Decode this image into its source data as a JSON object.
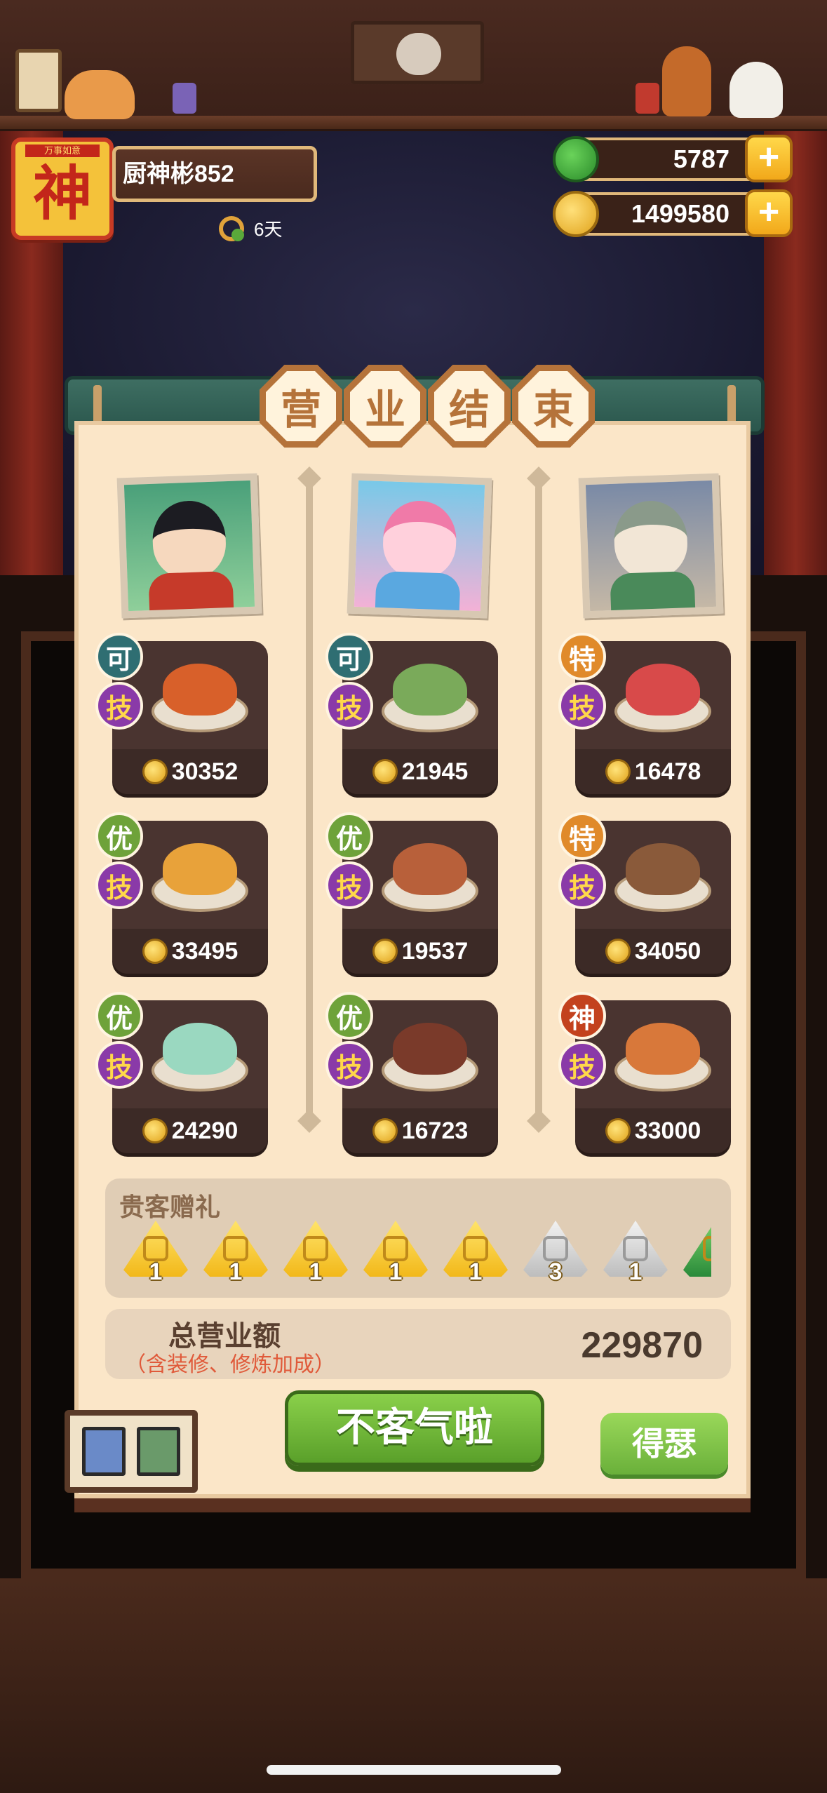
{
  "player": {
    "avatar_glyph": "神",
    "avatar_ribbon": "万事如意",
    "name": "厨神彬852",
    "days": "6天"
  },
  "currencies": {
    "jade": "5787",
    "coins": "1499580",
    "add_symbol": "+"
  },
  "dialog": {
    "title_chars": [
      "营",
      "业",
      "结",
      "束"
    ]
  },
  "chefs": [
    {
      "dishes": [
        {
          "grade": "可",
          "skill": "技",
          "price": "30352",
          "food_color": "#d8602a"
        },
        {
          "grade": "优",
          "skill": "技",
          "price": "33495",
          "food_color": "#e8a23a"
        },
        {
          "grade": "优",
          "skill": "技",
          "price": "24290",
          "food_color": "#9ad8c0"
        }
      ]
    },
    {
      "dishes": [
        {
          "grade": "可",
          "skill": "技",
          "price": "21945",
          "food_color": "#7aaa5a"
        },
        {
          "grade": "优",
          "skill": "技",
          "price": "19537",
          "food_color": "#b8603a"
        },
        {
          "grade": "优",
          "skill": "技",
          "price": "16723",
          "food_color": "#7a3a2a"
        }
      ]
    },
    {
      "dishes": [
        {
          "grade": "特",
          "skill": "技",
          "price": "16478",
          "food_color": "#d84a4a"
        },
        {
          "grade": "特",
          "skill": "技",
          "price": "34050",
          "food_color": "#8a5a3a"
        },
        {
          "grade": "神",
          "skill": "技",
          "price": "33000",
          "food_color": "#d8783a"
        }
      ]
    }
  ],
  "gifts": {
    "label": "贵客赠礼",
    "items": [
      {
        "count": "1",
        "style": "gold"
      },
      {
        "count": "1",
        "style": "gold"
      },
      {
        "count": "1",
        "style": "gold"
      },
      {
        "count": "1",
        "style": "gold"
      },
      {
        "count": "1",
        "style": "gold"
      },
      {
        "count": "3",
        "style": "silver"
      },
      {
        "count": "1",
        "style": "silver"
      },
      {
        "count": "",
        "style": "green"
      }
    ]
  },
  "total": {
    "label": "总营业额",
    "note": "（含装修、修炼加成）",
    "value": "229870"
  },
  "buttons": {
    "confirm": "不客气啦",
    "share": "得瑟"
  },
  "colors": {
    "grade_ke": "#2f6e72",
    "grade_you": "#6ea23a",
    "grade_te": "#e08a2a",
    "grade_shen": "#c3421e",
    "skill": "#8a3aa8",
    "confirm_green": "#6ab03a"
  }
}
